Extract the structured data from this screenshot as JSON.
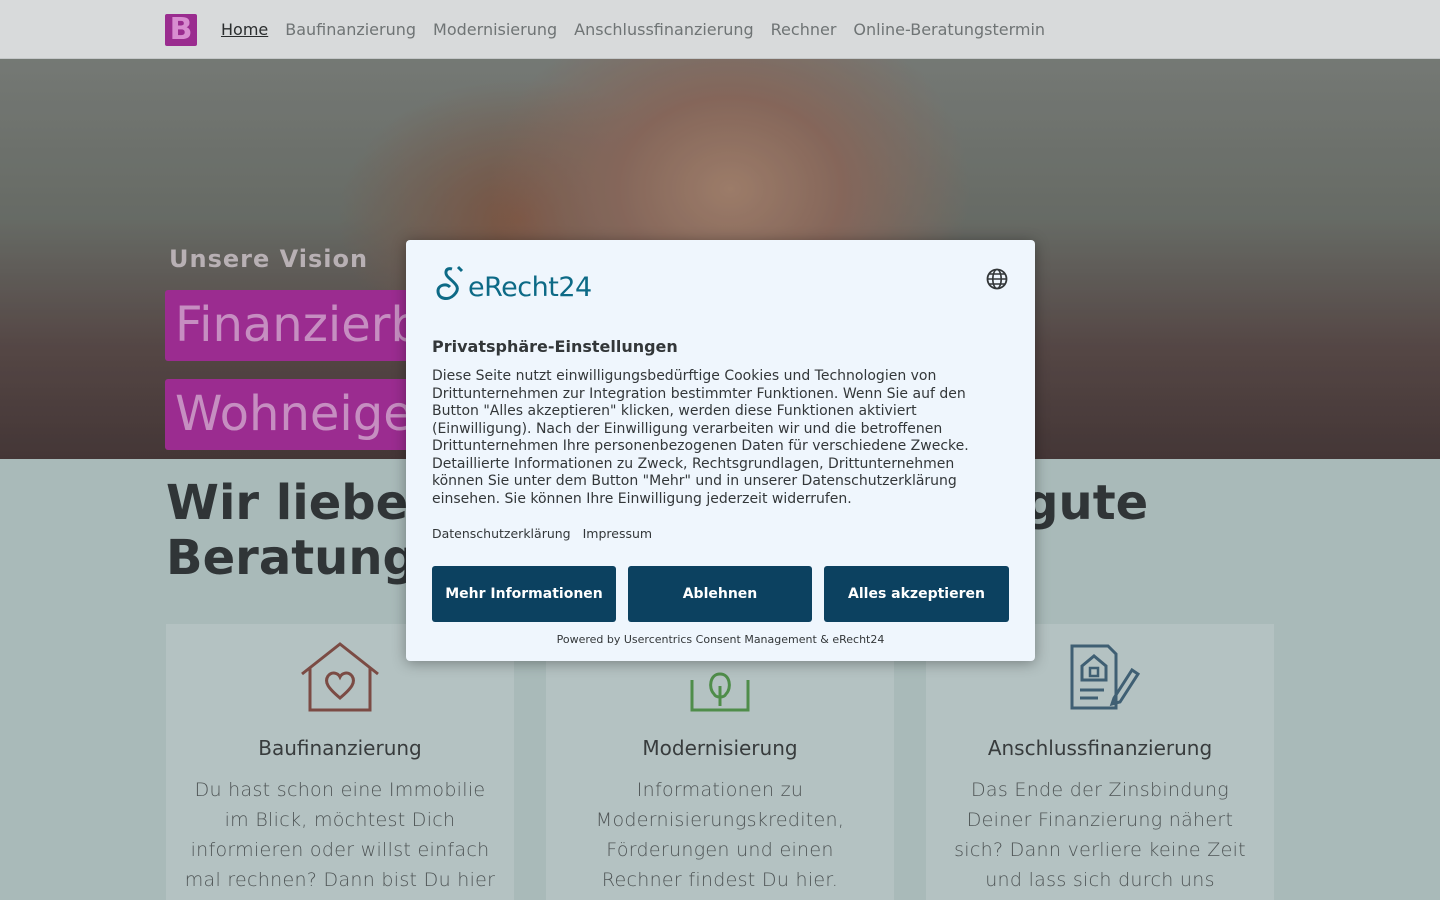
{
  "nav": {
    "logo_letter": "B",
    "links": [
      "Home",
      "Baufinanzierung",
      "Modernisierung",
      "Anschlussfinanzierung",
      "Rechner",
      "Online-Beratungstermin"
    ]
  },
  "hero": {
    "subtitle": "Unsere Vision",
    "pill_1": "Finanzierb",
    "pill_2": "Wohneige"
  },
  "headline": "Wir liebe                                        gute Beratung",
  "headline_left_1": "Wir liebe",
  "headline_right_1": "gute",
  "headline_left_2": "Beratung",
  "cards": [
    {
      "icon": "house-heart-icon",
      "title": "Baufinanzierung",
      "text": "Du hast schon eine Immobilie im Blick, möchtest Dich informieren oder willst einfach mal rechnen? Dann bist Du hier genau richtig?"
    },
    {
      "icon": "tree-frame-icon",
      "title": "Modernisierung",
      "text": "Informationen zu Modernisierungskrediten, Förderungen und einen Rechner findest Du hier."
    },
    {
      "icon": "document-house-pen-icon",
      "title": "Anschlussfinanzierung",
      "text": "Das Ende der Zinsbindung Deiner Finanzierung nähert sich? Dann verliere keine Zeit und lass sich durch uns beraten."
    }
  ],
  "consent": {
    "brand": "eRecht24",
    "title": "Privatsphäre-Einstellungen",
    "body": "Diese Seite nutzt einwilligungsbedürftige Cookies und Technologien von Drittunternehmen zur Integration bestimmter Funktionen. Wenn Sie auf den Button \"Alles akzeptieren\" klicken, werden diese Funktionen aktiviert (Einwilligung). Nach der Einwilligung verarbeiten wir und die betroffenen Drittunternehmen Ihre personenbezogenen Daten für verschiedene Zwecke. Detaillierte Informationen zu Zweck, Rechtsgrundlagen, Drittunternehmen können Sie unter dem Button \"Mehr\" und in unserer Datenschutzerklärung einsehen. Sie können Ihre Einwilligung jederzeit widerrufen.",
    "link_privacy": "Datenschutzerklärung",
    "link_imprint": "Impressum",
    "btn_more": "Mehr Informationen",
    "btn_deny": "Ablehnen",
    "btn_accept": "Alles akzeptieren",
    "powered": "Powered by Usercentrics Consent Management & eRecht24"
  },
  "colors": {
    "brand_magenta": "#9b2c90",
    "consent_button": "#0c4160",
    "erecht_teal": "#0d6a86"
  }
}
